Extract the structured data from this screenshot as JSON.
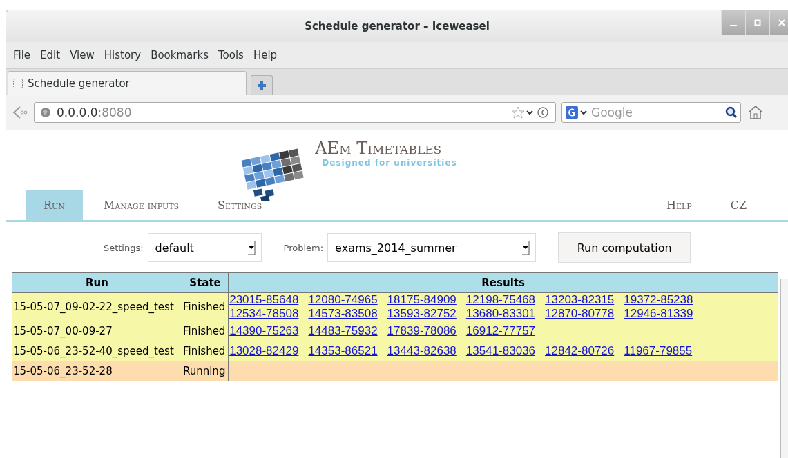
{
  "window": {
    "title": "Schedule generator – Iceweasel"
  },
  "menu": [
    "File",
    "Edit",
    "View",
    "History",
    "Bookmarks",
    "Tools",
    "Help"
  ],
  "tabs": [
    {
      "label": "Schedule generator",
      "selected": true
    }
  ],
  "address": {
    "host": "0.0.0.0",
    "port": ":8080"
  },
  "search": {
    "placeholder": "Google"
  },
  "logo": {
    "title": "AEm Timetables",
    "subtitle": "Designed for universities"
  },
  "nav": [
    {
      "label": "Run",
      "selected": true
    },
    {
      "label": "Manage inputs",
      "selected": false
    },
    {
      "label": "Settings",
      "selected": false
    }
  ],
  "nav_right": [
    {
      "label": "Help",
      "selected": false
    },
    {
      "label": "CZ",
      "selected": false
    }
  ],
  "form": {
    "settings_label": "Settings:",
    "settings_value": "default",
    "problem_label": "Problem:",
    "problem_value": "exams_2014_summer",
    "button": "Run computation"
  },
  "table": {
    "columns": [
      "Run",
      "State",
      "Results"
    ],
    "rows": [
      {
        "run": "15-05-07_09-02-22_speed_test",
        "state": "Finished",
        "kind": "finished",
        "results": [
          "23015-85648",
          "12080-74965",
          "18175-84909",
          "12198-75468",
          "13203-82315",
          "19372-85238",
          "12534-78508",
          "14573-83508",
          "13593-82752",
          "13680-83301",
          "12870-80778",
          "12946-81339"
        ]
      },
      {
        "run": "15-05-07_00-09-27",
        "state": "Finished",
        "kind": "finished",
        "results": [
          "14390-75263",
          "14483-75932",
          "17839-78086",
          "16912-77757"
        ]
      },
      {
        "run": "15-05-06_23-52-40_speed_test",
        "state": "Finished",
        "kind": "finished",
        "results": [
          "13028-82429",
          "14353-86521",
          "13443-82638",
          "13541-83036",
          "12842-80726",
          "11967-79855"
        ]
      },
      {
        "run": "15-05-06_23-52-28",
        "state": "Running",
        "kind": "running",
        "results": []
      }
    ]
  }
}
